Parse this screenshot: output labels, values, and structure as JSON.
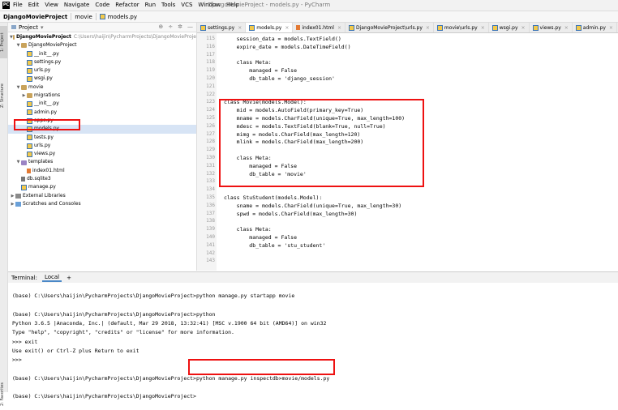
{
  "menubar": {
    "items": [
      "File",
      "Edit",
      "View",
      "Navigate",
      "Code",
      "Refactor",
      "Run",
      "Tools",
      "VCS",
      "Window",
      "Help"
    ],
    "title": "DjangoMovieProject - models.py - PyCharm"
  },
  "navbar": {
    "project": "DjangoMovieProject",
    "folder": "movie",
    "file": "models.py"
  },
  "left_strip": {
    "tab1": "1: Project",
    "tab2": "Z: Structure",
    "tab3": "2: Favorites"
  },
  "project_panel": {
    "header": "Project",
    "tree": [
      {
        "label": "DjangoMovieProject",
        "path": "C:\\Users\\haijin\\PycharmProjects\\DjangoMovieProje"
      },
      {
        "label": "DjangoMovieProject"
      },
      {
        "label": "__init__.py"
      },
      {
        "label": "settings.py"
      },
      {
        "label": "urls.py"
      },
      {
        "label": "wsgi.py"
      },
      {
        "label": "movie"
      },
      {
        "label": "migrations"
      },
      {
        "label": "__init__.py"
      },
      {
        "label": "admin.py"
      },
      {
        "label": "apps.py"
      },
      {
        "label": "models.py"
      },
      {
        "label": "tests.py"
      },
      {
        "label": "urls.py"
      },
      {
        "label": "views.py"
      },
      {
        "label": "templates"
      },
      {
        "label": "index01.html"
      },
      {
        "label": "db.sqlite3"
      },
      {
        "label": "manage.py"
      },
      {
        "label": "External Libraries"
      },
      {
        "label": "Scratches and Consoles"
      }
    ]
  },
  "editor_tabs": [
    {
      "label": "settings.py",
      "kind": "py"
    },
    {
      "label": "models.py",
      "kind": "py"
    },
    {
      "label": "index01.html",
      "kind": "html"
    },
    {
      "label": "DjangoMovieProject\\urls.py",
      "kind": "py"
    },
    {
      "label": "movie\\urls.py",
      "kind": "py"
    },
    {
      "label": "wsgi.py",
      "kind": "py"
    },
    {
      "label": "views.py",
      "kind": "py"
    },
    {
      "label": "admin.py",
      "kind": "py"
    }
  ],
  "editor": {
    "line_numbers": [
      "115",
      "116",
      "117",
      "118",
      "119",
      "120",
      "121",
      "122",
      "123",
      "124",
      "125",
      "126",
      "127",
      "128",
      "129",
      "130",
      "131",
      "132",
      "133",
      "134",
      "135",
      "136",
      "137",
      "138",
      "139",
      "140",
      "141",
      "142",
      "143"
    ],
    "lines": [
      "    session_data = models.TextField()",
      "    expire_date = models.DateTimeField()",
      "",
      "    class Meta:",
      "        managed = False",
      "        db_table = 'django_session'",
      "",
      "",
      "class Movie(models.Model):",
      "    mid = models.AutoField(primary_key=True)",
      "    mname = models.CharField(unique=True, max_length=100)",
      "    mdesc = models.TextField(blank=True, null=True)",
      "    mimg = models.CharField(max_length=120)",
      "    mlink = models.CharField(max_length=200)",
      "",
      "    class Meta:",
      "        managed = False",
      "        db_table = 'movie'",
      "",
      "",
      "class StuStudent(models.Model):",
      "    sname = models.CharField(unique=True, max_length=30)",
      "    spwd = models.CharField(max_length=30)",
      "",
      "    class Meta:",
      "        managed = False",
      "        db_table = 'stu_student'",
      "",
      ""
    ]
  },
  "terminal": {
    "label": "Terminal:",
    "tab": "Local",
    "add": "+",
    "lines": [
      "(base) C:\\Users\\haijin\\PycharmProjects\\DjangoMovieProject>python manage.py startapp movie",
      "",
      "(base) C:\\Users\\haijin\\PycharmProjects\\DjangoMovieProject>python",
      "Python 3.6.5 |Anaconda, Inc.| (default, Mar 29 2018, 13:32:41) [MSC v.1900 64 bit (AMD64)] on win32",
      "Type \"help\", \"copyright\", \"credits\" or \"license\" for more information.",
      ">>> exit",
      "Use exit() or Ctrl-Z plus Return to exit",
      ">>>",
      "",
      "(base) C:\\Users\\haijin\\PycharmProjects\\DjangoMovieProject>python manage.py inspectdb>movie/models.py",
      "",
      "(base) C:\\Users\\haijin\\PycharmProjects\\DjangoMovieProject>"
    ]
  }
}
